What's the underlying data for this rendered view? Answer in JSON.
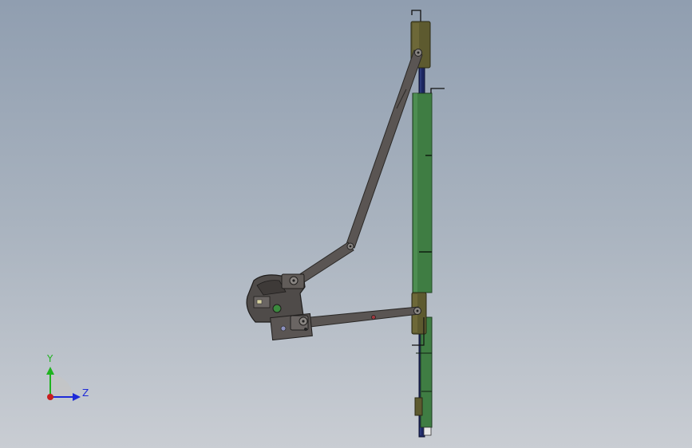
{
  "view": {
    "background_top": "#909eb0",
    "background_bottom": "#c9cdd3"
  },
  "model": {
    "frame_color": "#1c2660",
    "panel_color": "#3f7d43",
    "block_color": "#5d5a2f",
    "link_color": "#5a5553",
    "link_edge_color": "#2a2826"
  },
  "triad": {
    "y_label": "Y",
    "z_label": "Z",
    "y_color": "#1fb31f",
    "z_color": "#1d2ad8",
    "origin_color": "#c81e1e"
  }
}
